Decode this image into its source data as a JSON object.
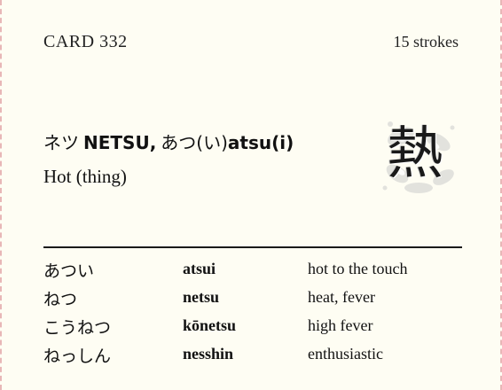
{
  "card": {
    "number_label": "CARD 332",
    "strokes_label": "15 strokes",
    "reading_on_kana": "ネツ",
    "reading_on_romaji": "NETSU,",
    "reading_kun_kana": "あつ(い)",
    "reading_kun_romaji": "atsu(i)",
    "meaning": "Hot (thing)",
    "kanji": "熱"
  },
  "vocab": [
    {
      "kana": "あつい",
      "romaji": "atsui",
      "meaning": "hot to the touch"
    },
    {
      "kana": "ねつ",
      "romaji": "netsu",
      "meaning": "heat, fever"
    },
    {
      "kana": "こうねつ",
      "romaji": "kōnetsu",
      "meaning": "high fever"
    },
    {
      "kana": "ねっしん",
      "romaji": "nesshin",
      "meaning": "enthusiastic"
    }
  ],
  "colors": {
    "card_background": "#fefdf3",
    "border_dash": "#e8b7b7",
    "text": "#111111"
  }
}
